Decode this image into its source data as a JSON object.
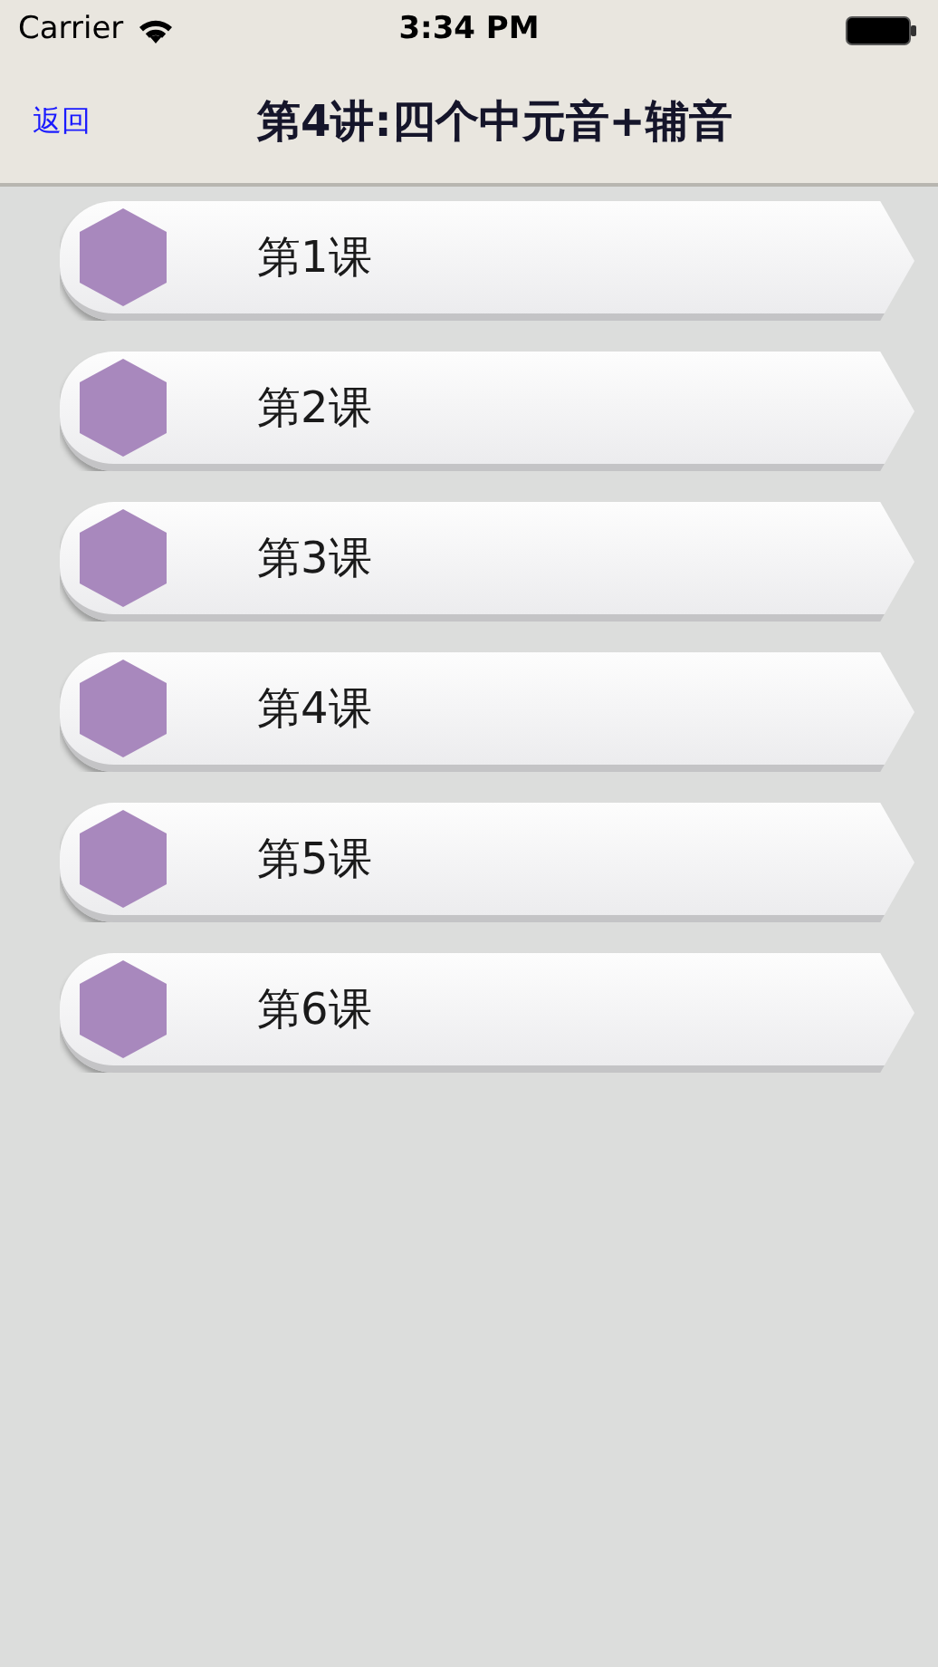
{
  "status_bar": {
    "carrier": "Carrier",
    "time": "3:34 PM"
  },
  "nav": {
    "back": "返回",
    "title": "第4讲:四个中元音+辅音"
  },
  "lessons": [
    {
      "label": "第1课"
    },
    {
      "label": "第2课"
    },
    {
      "label": "第3课"
    },
    {
      "label": "第4课"
    },
    {
      "label": "第5课"
    },
    {
      "label": "第6课"
    }
  ]
}
